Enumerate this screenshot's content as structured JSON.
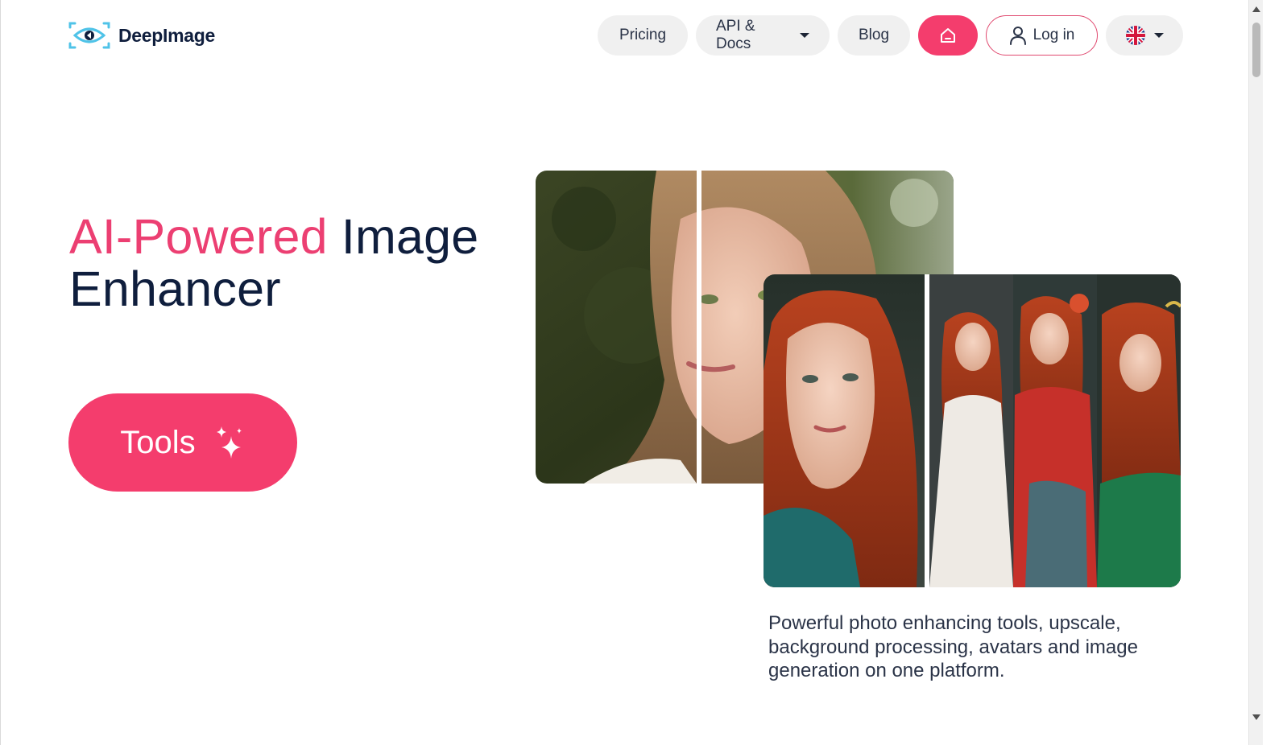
{
  "brand": {
    "name": "DeepImage",
    "accent": "#f43d6d",
    "ink": "#0f1e3d"
  },
  "nav": {
    "pricing": "Pricing",
    "api_docs": "API & Docs",
    "blog": "Blog",
    "home_icon": "home-icon",
    "login": "Log in",
    "language_icon": "uk-flag-icon"
  },
  "hero": {
    "title_accent": "AI-Powered",
    "title_rest": " Image",
    "title_line2": "Enhancer",
    "tools_button": "Tools",
    "tools_icon": "sparkles-icon"
  },
  "description": "Powerful photo enhancing tools, upscale, background processing, avatars and image generation on one platform."
}
